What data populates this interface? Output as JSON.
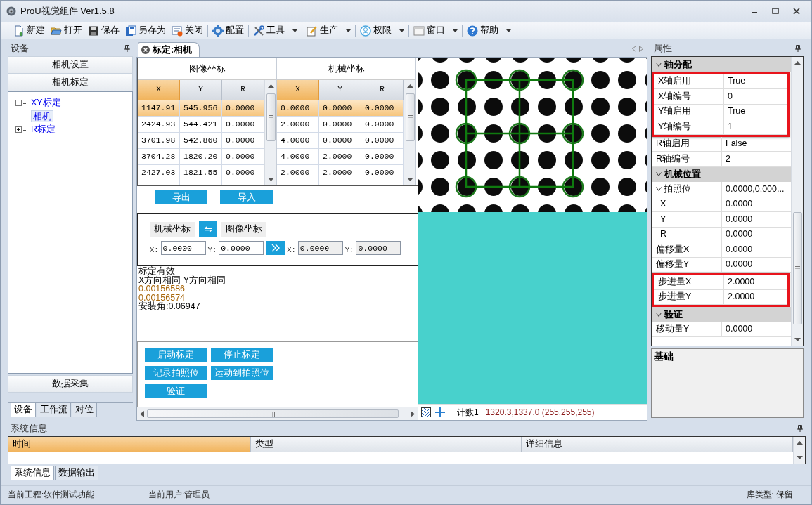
{
  "window": {
    "title": "ProU视觉组件 Ver1.5.8"
  },
  "toolbar": [
    {
      "items": [
        {
          "label": "新建",
          "dropdown": false
        },
        {
          "label": "打开",
          "dropdown": false
        },
        {
          "label": "保存",
          "dropdown": false
        },
        {
          "label": "另存为",
          "dropdown": false
        },
        {
          "label": "关闭",
          "dropdown": false
        }
      ]
    },
    {
      "items": [
        {
          "label": "配置",
          "dropdown": false
        }
      ]
    },
    {
      "items": [
        {
          "label": "工具",
          "dropdown": true
        }
      ]
    },
    {
      "items": [
        {
          "label": "生产",
          "dropdown": true
        }
      ]
    },
    {
      "items": [
        {
          "label": "权限",
          "dropdown": true
        }
      ]
    },
    {
      "items": [
        {
          "label": "窗口",
          "dropdown": true
        }
      ]
    },
    {
      "items": [
        {
          "label": "帮助",
          "dropdown": true
        }
      ]
    }
  ],
  "device_panel": {
    "title": "设备",
    "sections": [
      {
        "label": "相机设置"
      },
      {
        "label": "相机标定"
      }
    ],
    "tree": [
      {
        "label": "XY标定",
        "selected": false,
        "expanded": true,
        "children": [
          {
            "label": "相机",
            "selected": true
          }
        ]
      },
      {
        "label": "R标定",
        "selected": false,
        "expanded": false
      }
    ],
    "footer_sections": [
      {
        "label": "数据采集"
      }
    ],
    "tabs": [
      {
        "label": "设备",
        "selected": true
      },
      {
        "label": "工作流",
        "selected": false
      },
      {
        "label": "对位",
        "selected": false
      }
    ]
  },
  "document": {
    "tab": {
      "label": "标定:相机"
    },
    "table": {
      "groups": [
        {
          "title": "图像坐标",
          "columns": [
            {
              "label": "X",
              "selected": true
            },
            {
              "label": "Y",
              "selected": false
            },
            {
              "label": "R",
              "selected": false
            }
          ]
        },
        {
          "title": "机械坐标",
          "columns": [
            {
              "label": "X",
              "selected": true
            },
            {
              "label": "Y",
              "selected": false
            },
            {
              "label": "R",
              "selected": false
            }
          ]
        }
      ],
      "rows": [
        {
          "selected": true,
          "cells": [
            "1147.91",
            "545.956",
            "0.0000",
            "0.0000",
            "0.0000",
            "0.0000"
          ]
        },
        {
          "selected": false,
          "cells": [
            "2424.93",
            "544.421",
            "0.0000",
            "2.0000",
            "0.0000",
            "0.0000"
          ]
        },
        {
          "selected": false,
          "cells": [
            "3701.98",
            "542.860",
            "0.0000",
            "4.0000",
            "0.0000",
            "0.0000"
          ]
        },
        {
          "selected": false,
          "cells": [
            "3704.28",
            "1820.20",
            "0.0000",
            "4.0000",
            "2.0000",
            "0.0000"
          ]
        },
        {
          "selected": false,
          "cells": [
            "2427.03",
            "1821.55",
            "0.0000",
            "2.0000",
            "2.0000",
            "0.0000"
          ]
        }
      ]
    },
    "table_buttons": [
      "导出",
      "导入"
    ],
    "converter": {
      "from": "机械坐标",
      "swap": "⇋",
      "to": "图像坐标",
      "source_inputs": [
        {
          "label": "X:",
          "value": "0.0000",
          "readonly": false
        },
        {
          "label": "Y:",
          "value": "0.0000",
          "readonly": false
        }
      ],
      "result_inputs": [
        {
          "label": "X:",
          "value": "0.0000",
          "readonly": true
        },
        {
          "label": "Y:",
          "value": "0.0000",
          "readonly": true
        }
      ]
    },
    "log": [
      {
        "text": "标定有效",
        "kind": "message"
      },
      {
        "text": "X方向相同 Y方向相同",
        "kind": "message"
      },
      {
        "text": "0.00156586",
        "kind": "value"
      },
      {
        "text": "0.00156574",
        "kind": "value"
      },
      {
        "text": "安装角:0.06947",
        "kind": "message"
      }
    ],
    "actions": [
      "启动标定",
      "停止标定",
      "记录拍照位",
      "运动到拍照位",
      "验证"
    ],
    "viewer": {
      "count": "计数1",
      "coords": "1320.3,1337.0 (255,255,255)"
    }
  },
  "properties": {
    "title": "属性",
    "categories": [
      {
        "label": "轴分配",
        "expanded": true,
        "rows": [
          {
            "label": "X轴启用",
            "value": "True",
            "highlighted": true
          },
          {
            "label": "X轴编号",
            "value": "0",
            "highlighted": true
          },
          {
            "label": "Y轴启用",
            "value": "True",
            "highlighted": true
          },
          {
            "label": "Y轴编号",
            "value": "1",
            "highlighted": true
          },
          {
            "label": "R轴启用",
            "value": "False",
            "highlighted": false
          },
          {
            "label": "R轴编号",
            "value": "2",
            "highlighted": false
          }
        ]
      },
      {
        "label": "机械位置",
        "expanded": true,
        "rows": [
          {
            "label": "拍照位",
            "value": "0.0000,0.000...",
            "highlighted": false,
            "expanded": true,
            "children": [
              {
                "label": "X",
                "value": "0.0000",
                "highlighted": false
              },
              {
                "label": "Y",
                "value": "0.0000",
                "highlighted": false
              },
              {
                "label": "R",
                "value": "0.0000",
                "highlighted": false
              }
            ]
          },
          {
            "label": "偏移量X",
            "value": "0.0000",
            "highlighted": false
          },
          {
            "label": "偏移量Y",
            "value": "0.0000",
            "highlighted": false
          },
          {
            "label": "步进量X",
            "value": "2.0000",
            "highlighted": true
          },
          {
            "label": "步进量Y",
            "value": "2.0000",
            "highlighted": true
          }
        ]
      },
      {
        "label": "验证",
        "expanded": true,
        "rows": [
          {
            "label": "移动量Y",
            "value": "0.0000",
            "highlighted": false
          }
        ]
      }
    ],
    "description": "基础"
  },
  "system_info": {
    "title": "系统信息",
    "columns": [
      {
        "label": "时间",
        "selected": true
      },
      {
        "label": "类型",
        "selected": false
      },
      {
        "label": "详细信息",
        "selected": false
      }
    ],
    "tabs": [
      {
        "label": "系统信息",
        "selected": true
      },
      {
        "label": "数据输出",
        "selected": false
      }
    ]
  },
  "status_bar": {
    "project": "当前工程:软件测试功能",
    "user": "当前用户:管理员",
    "library": "库类型: 保留"
  }
}
